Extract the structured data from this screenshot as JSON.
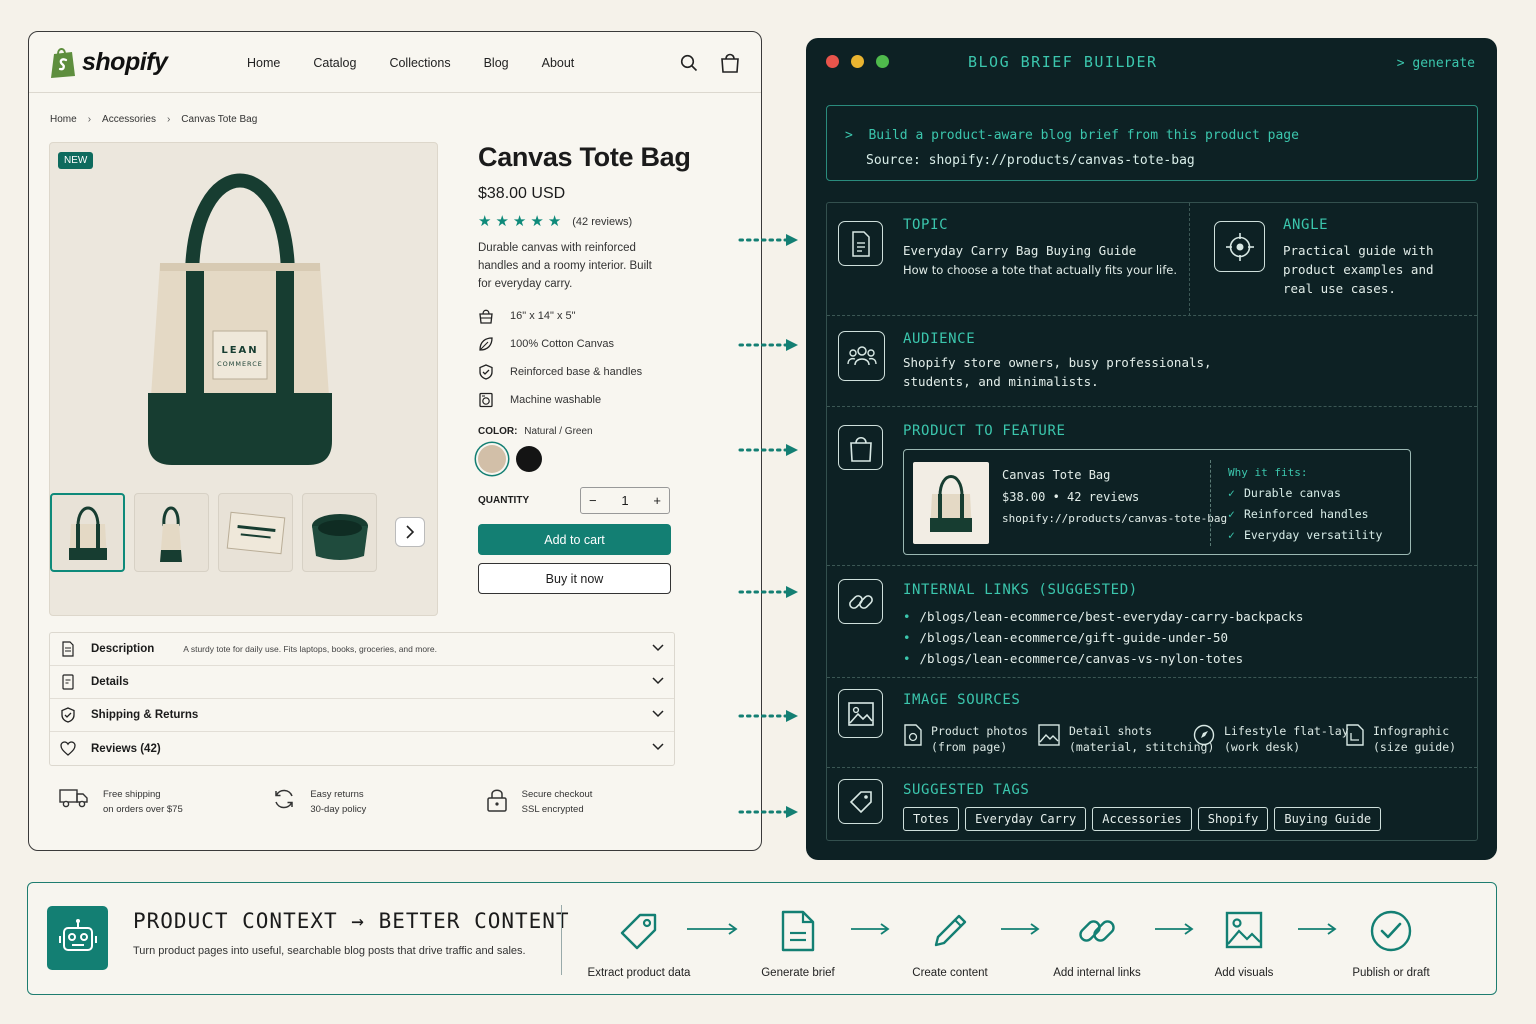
{
  "store": {
    "logo_text": "shopify",
    "nav": [
      "Home",
      "Catalog",
      "Collections",
      "Blog",
      "About"
    ],
    "breadcrumb": [
      "Home",
      "Accessories",
      "Canvas Tote Bag"
    ],
    "badge": "NEW",
    "bag_label": [
      "LEAN",
      "COMMERCE"
    ],
    "product": {
      "title": "Canvas Tote Bag",
      "price": "$38.00 USD",
      "rating": 5,
      "reviews": "(42 reviews)",
      "description": "Durable canvas with reinforced handles and a roomy interior. Built for everyday carry.",
      "features": [
        {
          "icon": "bag-icon",
          "text": "16\" x 14\" x 5\""
        },
        {
          "icon": "leaf-icon",
          "text": "100% Cotton Canvas"
        },
        {
          "icon": "shield-check-icon",
          "text": "Reinforced base & handles"
        },
        {
          "icon": "washer-icon",
          "text": "Machine washable"
        }
      ],
      "color_label": "COLOR:",
      "color_value": "Natural / Green",
      "swatch_colors": [
        "#d2bfa8",
        "#141414"
      ],
      "quantity_label": "QUANTITY",
      "quantity_value": "1",
      "qty_minus": "−",
      "qty_plus": "+",
      "add_to_cart": "Add to cart",
      "buy_now": "Buy it now"
    },
    "accordion": [
      {
        "title": "Description",
        "sub": "A sturdy tote for daily use. Fits laptops, books, groceries, and more.",
        "icon": "document-icon"
      },
      {
        "title": "Details",
        "sub": "",
        "icon": "details-icon"
      },
      {
        "title": "Shipping & Returns",
        "sub": "",
        "icon": "shield-icon"
      },
      {
        "title": "Reviews (42)",
        "sub": "",
        "icon": "heart-icon"
      }
    ],
    "trust": [
      {
        "title": "Free shipping",
        "sub": "on orders over $75",
        "icon": "truck-icon"
      },
      {
        "title": "Easy returns",
        "sub": "30-day policy",
        "icon": "refresh-icon"
      },
      {
        "title": "Secure checkout",
        "sub": "SSL encrypted",
        "icon": "lock-icon"
      }
    ]
  },
  "terminal": {
    "title": "BLOG BRIEF BUILDER",
    "generate": "> generate",
    "command_prompt": ">",
    "command": "Build a product-aware blog brief from this product page",
    "source": "Source: shopify://products/canvas-tote-bag",
    "topic": {
      "heading": "TOPIC",
      "title": "Everyday Carry Bag Buying Guide",
      "sub": "How to choose a tote that actually fits your life."
    },
    "angle": {
      "heading": "ANGLE",
      "lines": [
        "Practical guide with",
        "product examples and",
        "real use cases."
      ]
    },
    "audience": {
      "heading": "AUDIENCE",
      "lines": [
        "Shopify store owners, busy professionals,",
        "students, and minimalists."
      ]
    },
    "feature": {
      "heading": "PRODUCT TO FEATURE",
      "name": "Canvas Tote Bag",
      "price_reviews": "$38.00  •  42 reviews",
      "url": "shopify://products/canvas-tote-bag",
      "why_heading": "Why it fits:",
      "why": [
        "Durable canvas",
        "Reinforced handles",
        "Everyday versatility"
      ]
    },
    "links": {
      "heading": "INTERNAL LINKS (SUGGESTED)",
      "items": [
        "/blogs/lean-ecommerce/best-everyday-carry-backpacks",
        "/blogs/lean-ecommerce/gift-guide-under-50",
        "/blogs/lean-ecommerce/canvas-vs-nylon-totes"
      ]
    },
    "images": {
      "heading": "IMAGE SOURCES",
      "items": [
        {
          "title": "Product photos",
          "sub": "(from page)",
          "icon": "camera-doc-icon"
        },
        {
          "title": "Detail shots",
          "sub": "(material, stitching)",
          "icon": "detail-image-icon"
        },
        {
          "title": "Lifestyle flat-lay",
          "sub": "(work desk)",
          "icon": "compass-icon"
        },
        {
          "title": "Infographic",
          "sub": "(size guide)",
          "icon": "chart-doc-icon"
        }
      ]
    },
    "tags": {
      "heading": "SUGGESTED TAGS",
      "items": [
        "Totes",
        "Everyday Carry",
        "Accessories",
        "Shopify",
        "Buying Guide"
      ]
    }
  },
  "banner": {
    "title": "PRODUCT CONTEXT → BETTER CONTENT",
    "subtitle": "Turn product pages into useful, searchable blog posts that drive traffic and sales.",
    "steps": [
      {
        "label": "Extract product data",
        "icon": "tag-icon"
      },
      {
        "label": "Generate brief",
        "icon": "document-icon"
      },
      {
        "label": "Create content",
        "icon": "pencil-icon"
      },
      {
        "label": "Add internal links",
        "icon": "link-icon"
      },
      {
        "label": "Add visuals",
        "icon": "image-icon"
      },
      {
        "label": "Publish or draft",
        "icon": "check-circle-icon"
      }
    ]
  },
  "colors": {
    "accent": "#137f73",
    "terminal_bg": "#0d2124",
    "terminal_accent": "#3bc6ad",
    "page_bg": "#f5f2ea"
  }
}
